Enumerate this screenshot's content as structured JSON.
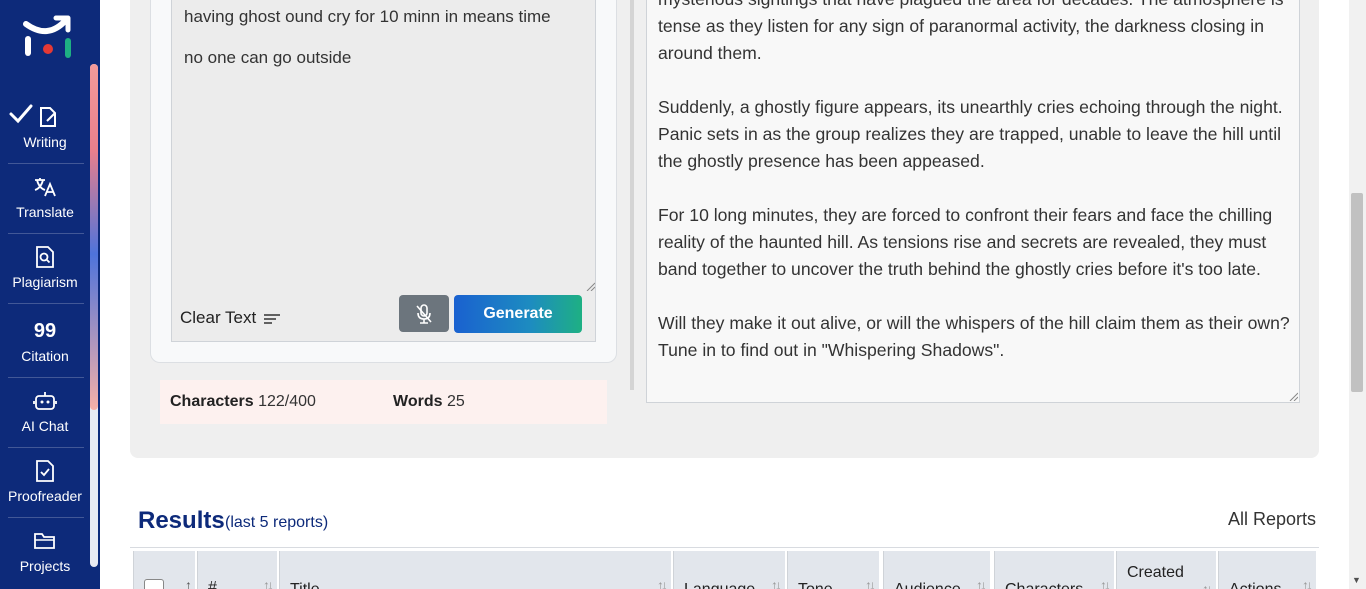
{
  "sidebar": {
    "items": [
      {
        "label": "Writing",
        "icon": "edit-document-icon",
        "active": true
      },
      {
        "label": "Translate",
        "icon": "translate-icon"
      },
      {
        "label": "Plagiarism",
        "icon": "search-document-icon"
      },
      {
        "label": "Citation",
        "icon": "quote-icon",
        "glyph": "99"
      },
      {
        "label": "AI Chat",
        "icon": "robot-icon"
      },
      {
        "label": "Proofreader",
        "icon": "check-document-icon"
      },
      {
        "label": "Projects",
        "icon": "folder-icon"
      }
    ]
  },
  "input": {
    "lines": [
      "having ghost ound cry for 10 minn in means time",
      "no one can go outside"
    ],
    "clear_label": "Clear Text",
    "generate_label": "Generate"
  },
  "stats": {
    "characters_label": "Characters",
    "characters_value": "122/400",
    "words_label": "Words",
    "words_value": "25"
  },
  "output": {
    "paragraphs": [
      "mysterious sightings that have plagued the area for decades. The atmosphere is tense as they listen for any sign of paranormal activity, the darkness closing in around them.",
      "Suddenly, a ghostly figure appears, its unearthly cries echoing through the night. Panic sets in as the group realizes they are trapped, unable to leave the hill until the ghostly presence has been appeased.",
      "For 10 long minutes, they are forced to confront their fears and face the chilling reality of the haunted hill. As tensions rise and secrets are revealed, they must band together to uncover the truth behind the ghostly cries before it's too late.",
      "Will they make it out alive, or will the whispers of the hill claim them as their own? Tune in to find out in \"Whispering Shadows\"."
    ]
  },
  "results": {
    "title": "Results",
    "subtitle": "(last 5 reports)",
    "all_reports": "All Reports",
    "columns": [
      "#",
      "Title",
      "Language",
      "Tone",
      "Audience",
      "Characters",
      "Created Date",
      "Actions"
    ]
  },
  "colors": {
    "sidebar": "#0d2a7a",
    "brand_red": "#e53935",
    "brand_green": "#1eb083"
  }
}
